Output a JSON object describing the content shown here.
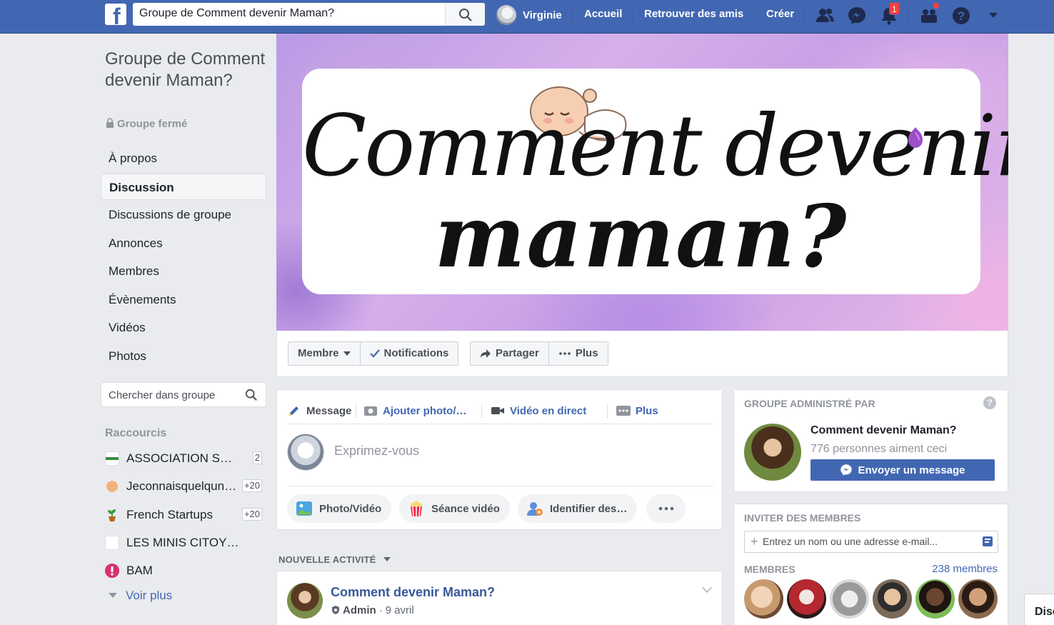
{
  "header": {
    "logo_letter": "f",
    "search_value": "Groupe de Comment devenir Maman?",
    "user_name": "Virginie",
    "nav": [
      "Accueil",
      "Retrouver des amis",
      "Créer"
    ],
    "notifications_count": "1"
  },
  "group": {
    "title": "Groupe de Comment devenir Maman?",
    "status": "Groupe fermé",
    "nav_items": [
      "À propos",
      "Discussion",
      "Discussions de groupe",
      "Annonces",
      "Membres",
      "Évènements",
      "Vidéos",
      "Photos"
    ],
    "active_item": "Discussion",
    "search_placeholder": "Chercher dans groupe"
  },
  "shortcuts": {
    "title": "Raccourcis",
    "items": [
      {
        "label": "ASSOCIATION SUPPORT",
        "count": "2"
      },
      {
        "label": "Jeconnaisquelqundequi",
        "count": "+20"
      },
      {
        "label": "French Startups",
        "count": "+20"
      },
      {
        "label": "LES MINIS CITOYENS",
        "count": ""
      },
      {
        "label": "BAM",
        "count": ""
      }
    ],
    "more_label": "Voir plus"
  },
  "cover": {
    "line1": "Comment devenir",
    "line2": "maman?"
  },
  "actions": {
    "member": "Membre",
    "notifications": "Notifications",
    "share": "Partager",
    "more": "Plus"
  },
  "composer": {
    "tabs": [
      "Message",
      "Ajouter photo/…",
      "Vidéo en direct",
      "Plus"
    ],
    "placeholder": "Exprimez-vous",
    "pills": [
      "Photo/Vidéo",
      "Séance vidéo",
      "Identifier des…"
    ]
  },
  "feed": {
    "section_label": "NOUVELLE ACTIVITÉ",
    "post": {
      "author": "Comment devenir Maman?",
      "role": "Admin",
      "date": "9 avril"
    }
  },
  "admin_card": {
    "title": "GROUPE ADMINISTRÉ PAR",
    "help": "?",
    "name": "Comment devenir Maman?",
    "likes": "776 personnes aiment ceci",
    "message_button": "Envoyer un message"
  },
  "invite_card": {
    "title": "INVITER DES MEMBRES",
    "input_placeholder": "Entrez un nom ou une adresse e-mail...",
    "members_label": "MEMBRES",
    "members_count": "238 membres"
  },
  "chat_tab_label": "Discussion",
  "colors": {
    "brand": "#4267b2",
    "link": "#385898",
    "badge": "#fa3e3e",
    "page_bg": "#e9ebee"
  }
}
